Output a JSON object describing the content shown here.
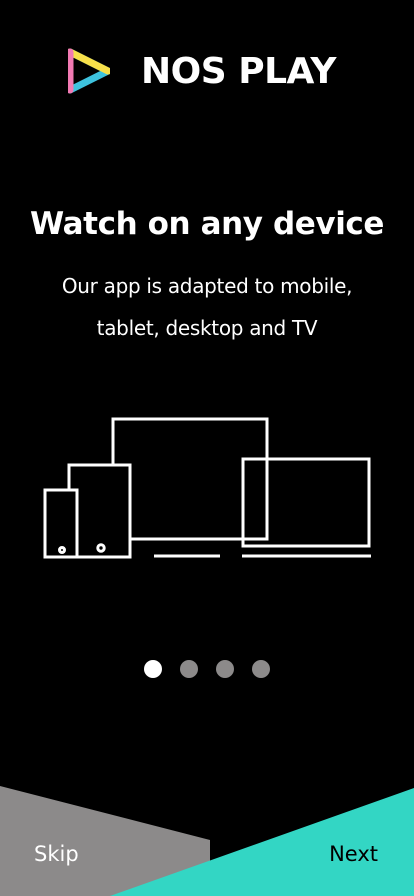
{
  "app": {
    "brand_name": "NOS PLAY",
    "logo_icon": "nos-play-logo-icon"
  },
  "onboarding": {
    "headline": "Watch on any device",
    "description": "Our app is adapted to mobile, tablet, desktop and TV",
    "illustration_icon": "devices-icon",
    "page_indicator": {
      "total_pages": 4,
      "current_page": 1
    }
  },
  "actions": {
    "skip_label": "Skip",
    "next_label": "Next"
  },
  "colors": {
    "background": "#000000",
    "text": "#ffffff",
    "accent_teal": "#33d6c4",
    "skip_area_gray": "#8c8a8a",
    "dot_inactive": "#8c8a8a",
    "dot_active": "#ffffff",
    "logo_pink": "#f27ab3",
    "logo_yellow": "#f7e04a",
    "logo_blue": "#3dc2de"
  }
}
